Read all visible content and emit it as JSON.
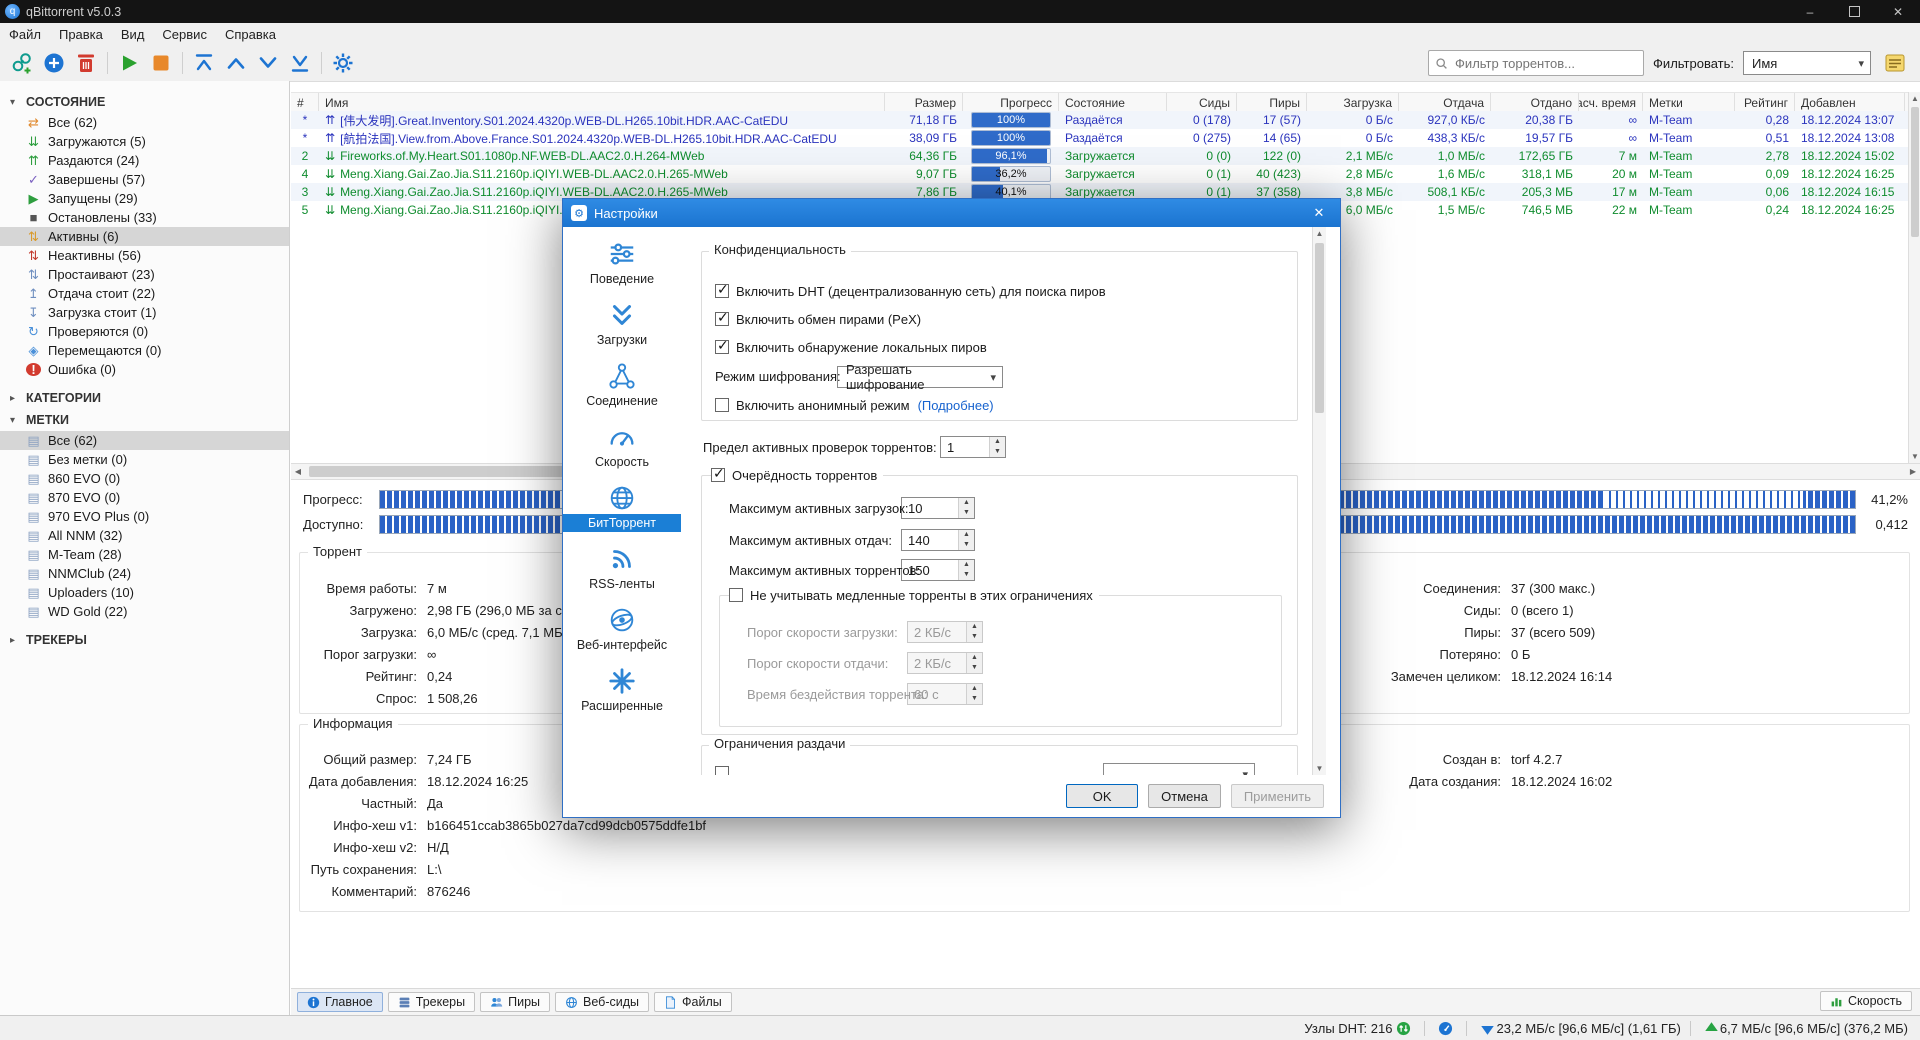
{
  "window": {
    "title": "qBittorrent v5.0.3"
  },
  "menu": [
    "Файл",
    "Правка",
    "Вид",
    "Сервис",
    "Справка"
  ],
  "toolbar": {
    "buttons": [
      "add-link-icon",
      "add-torrent-icon",
      "delete-icon",
      "resume-icon",
      "stop-icon",
      "move-top-icon",
      "move-up-icon",
      "move-down-icon",
      "move-bottom-icon",
      "settings-icon"
    ],
    "search_placeholder": "Фильтр торрентов...",
    "filter_label": "Фильтровать:",
    "filter_value": "Имя",
    "log_icon": "execution-log-icon"
  },
  "sidebar": {
    "sections": [
      {
        "title": "СОСТОЯНИЕ",
        "arrow": "▾",
        "items": [
          {
            "icon": "all",
            "label": "Все (62)",
            "selected": false
          },
          {
            "icon": "downloading",
            "label": "Загружаются (5)",
            "selected": false
          },
          {
            "icon": "seeding",
            "label": "Раздаются (24)",
            "selected": false
          },
          {
            "icon": "completed",
            "label": "Завершены (57)",
            "selected": false
          },
          {
            "icon": "running",
            "label": "Запущены (29)",
            "selected": false
          },
          {
            "icon": "stopped",
            "label": "Остановлены (33)",
            "selected": false
          },
          {
            "icon": "active",
            "label": "Активны (6)",
            "selected": true
          },
          {
            "icon": "inactive",
            "label": "Неактивны (56)",
            "selected": false
          },
          {
            "icon": "stalled",
            "label": "Простаивают (23)",
            "selected": false
          },
          {
            "icon": "stalled-up",
            "label": "Отдача стоит (22)",
            "selected": false
          },
          {
            "icon": "stalled-down",
            "label": "Загрузка стоит (1)",
            "selected": false
          },
          {
            "icon": "checking",
            "label": "Проверяются (0)",
            "selected": false
          },
          {
            "icon": "moving",
            "label": "Перемещаются (0)",
            "selected": false
          },
          {
            "icon": "error",
            "label": "Ошибка (0)",
            "selected": false
          }
        ]
      },
      {
        "title": "КАТЕГОРИИ",
        "arrow": "▸",
        "items": []
      },
      {
        "title": "МЕТКИ",
        "arrow": "▾",
        "items": [
          {
            "icon": "tag",
            "label": "Все (62)",
            "selected": true
          },
          {
            "icon": "tag",
            "label": "Без метки (0)",
            "selected": false
          },
          {
            "icon": "tag",
            "label": "860 EVO (0)",
            "selected": false
          },
          {
            "icon": "tag",
            "label": "870 EVO (0)",
            "selected": false
          },
          {
            "icon": "tag",
            "label": "970 EVO Plus (0)",
            "selected": false
          },
          {
            "icon": "tag",
            "label": "All NNM (32)",
            "selected": false
          },
          {
            "icon": "tag",
            "label": "M-Team (28)",
            "selected": false
          },
          {
            "icon": "tag",
            "label": "NNMClub (24)",
            "selected": false
          },
          {
            "icon": "tag",
            "label": "Uploaders (10)",
            "selected": false
          },
          {
            "icon": "tag",
            "label": "WD Gold (22)",
            "selected": false
          }
        ]
      },
      {
        "title": "ТРЕКЕРЫ",
        "arrow": "▸",
        "items": []
      }
    ]
  },
  "table": {
    "columns": [
      "#",
      "Имя",
      "Размер",
      "Прогресс",
      "Состояние",
      "Сиды",
      "Пиры",
      "Загрузка",
      "Отдача",
      "Отдано",
      "Расч. время",
      "Метки",
      "Рейтинг",
      "Добавлен"
    ],
    "rows": [
      {
        "n": "*",
        "kind": "seed",
        "name": "[伟大发明].Great.Inventory.S01.2024.4320p.WEB-DL.H265.10bit.HDR.AAC-CatEDU",
        "size": "71,18 ГБ",
        "pr": 100,
        "prText": "100%",
        "state": "Раздаётся",
        "seeds": "0 (178)",
        "peers": "17 (57)",
        "dl": "0 Б/с",
        "ul": "927,0 КБ/с",
        "uped": "20,38 ГБ",
        "eta": "∞",
        "tags": "M-Team",
        "ratio": "0,28",
        "added": "18.12.2024 13:07"
      },
      {
        "n": "*",
        "kind": "seed",
        "name": "[航拍法国].View.from.Above.France.S01.2024.4320p.WEB-DL.H265.10bit.HDR.AAC-CatEDU",
        "size": "38,09 ГБ",
        "pr": 100,
        "prText": "100%",
        "state": "Раздаётся",
        "seeds": "0 (275)",
        "peers": "14 (65)",
        "dl": "0 Б/с",
        "ul": "438,3 КБ/с",
        "uped": "19,57 ГБ",
        "eta": "∞",
        "tags": "M-Team",
        "ratio": "0,51",
        "added": "18.12.2024 13:08"
      },
      {
        "n": "2",
        "kind": "down",
        "name": "Fireworks.of.My.Heart.S01.1080p.NF.WEB-DL.AAC2.0.H.264-MWeb",
        "size": "64,36 ГБ",
        "pr": 96.1,
        "prText": "96,1%",
        "state": "Загружается",
        "seeds": "0 (0)",
        "peers": "122 (0)",
        "dl": "2,1 МБ/с",
        "ul": "1,0 МБ/с",
        "uped": "172,65 ГБ",
        "eta": "7 м",
        "tags": "M-Team",
        "ratio": "2,78",
        "added": "18.12.2024 15:02"
      },
      {
        "n": "4",
        "kind": "down",
        "name": "Meng.Xiang.Gai.Zao.Jia.S11.2160p.iQIYI.WEB-DL.AAC2.0.H.265-MWeb",
        "size": "9,07 ГБ",
        "pr": 36.2,
        "prText": "36,2%",
        "state": "Загружается",
        "seeds": "0 (1)",
        "peers": "40 (423)",
        "dl": "2,8 МБ/с",
        "ul": "1,6 МБ/с",
        "uped": "318,1 МБ",
        "eta": "20 м",
        "tags": "M-Team",
        "ratio": "0,09",
        "added": "18.12.2024 16:25"
      },
      {
        "n": "3",
        "kind": "down",
        "name": "Meng.Xiang.Gai.Zao.Jia.S11.2160p.iQIYI.WEB-DL.AAC2.0.H.265-MWeb",
        "size": "7,86 ГБ",
        "pr": 40.1,
        "prText": "40,1%",
        "state": "Загружается",
        "seeds": "0 (1)",
        "peers": "37 (358)",
        "dl": "3,8 МБ/с",
        "ul": "508,1 КБ/с",
        "uped": "205,3 МБ",
        "eta": "17 м",
        "tags": "M-Team",
        "ratio": "0,06",
        "added": "18.12.2024 16:15"
      },
      {
        "n": "5",
        "kind": "down",
        "name": "Meng.Xiang.Gai.Zao.Jia.S11.2160p.iQIYI.WEB-DL.AAC2.0.H.265-MWeb",
        "size": "",
        "pr": null,
        "prText": "",
        "state": "",
        "seeds": "",
        "peers": "",
        "dl": "6,0 МБ/с",
        "ul": "1,5 МБ/с",
        "uped": "746,5 МБ",
        "eta": "22 м",
        "tags": "M-Team",
        "ratio": "0,24",
        "added": "18.12.2024 16:25"
      }
    ]
  },
  "details": {
    "progress_label": "Прогресс:",
    "progress_value": "41,2%",
    "avail_label": "Доступно:",
    "avail_value": "0,412",
    "torrent_group": "Торрент",
    "torrent_left": [
      [
        "Время работы:",
        "7 м"
      ],
      [
        "Загружено:",
        "2,98 ГБ (296,0 МБ за сеанс)"
      ],
      [
        "Загрузка:",
        "6,0 МБ/с (сред. 7,1 МБ/с)"
      ],
      [
        "Порог загрузки:",
        "∞"
      ],
      [
        "Рейтинг:",
        "0,24"
      ],
      [
        "Спрос:",
        "1 508,26"
      ]
    ],
    "torrent_right": [
      [
        "Соединения:",
        "37 (300 макс.)"
      ],
      [
        "Сиды:",
        "0 (всего 1)"
      ],
      [
        "Пиры:",
        "37 (всего 509)"
      ],
      [
        "Потеряно:",
        "0 Б"
      ],
      [
        "Замечен целиком:",
        "18.12.2024 16:14"
      ]
    ],
    "info_group": "Информация",
    "info_left": [
      [
        "Общий размер:",
        "7,24 ГБ"
      ],
      [
        "Дата добавления:",
        "18.12.2024 16:25"
      ],
      [
        "Частный:",
        "Да"
      ],
      [
        "Инфо-хеш v1:",
        "b166451ccab3865b027da7cd99dcb0575ddfe1bf"
      ],
      [
        "Инфо-хеш v2:",
        "Н/Д"
      ],
      [
        "Путь сохранения:",
        "L:\\"
      ],
      [
        "Комментарий:",
        "876246"
      ]
    ],
    "info_right": [
      [
        "Создан в:",
        "torf 4.2.7"
      ],
      [
        "Дата создания:",
        "18.12.2024 16:02"
      ]
    ],
    "tabs": [
      {
        "icon": "info",
        "label": "Главное",
        "selected": true
      },
      {
        "icon": "trackers",
        "label": "Трекеры",
        "selected": false
      },
      {
        "icon": "peers",
        "label": "Пиры",
        "selected": false
      },
      {
        "icon": "webseeds",
        "label": "Веб-сиды",
        "selected": false
      },
      {
        "icon": "files",
        "label": "Файлы",
        "selected": false
      }
    ],
    "speed_button": "Скорость"
  },
  "dialog": {
    "title": "Настройки",
    "nav": [
      {
        "icon": "behavior",
        "label": "Поведение",
        "selected": false
      },
      {
        "icon": "downloads",
        "label": "Загрузки",
        "selected": false
      },
      {
        "icon": "connection",
        "label": "Соединение",
        "selected": false
      },
      {
        "icon": "speed",
        "label": "Скорость",
        "selected": false
      },
      {
        "icon": "bittorrent",
        "label": "БитТоррент",
        "selected": true
      },
      {
        "icon": "rss",
        "label": "RSS-ленты",
        "selected": false
      },
      {
        "icon": "webui",
        "label": "Веб-интерфейс",
        "selected": false
      },
      {
        "icon": "advanced",
        "label": "Расширенные",
        "selected": false
      }
    ],
    "section_privacy": "Конфиденциальность",
    "privacy_checkboxes": [
      {
        "checked": true,
        "label": "Включить DHT (децентрализованную сеть) для поиска пиров"
      },
      {
        "checked": true,
        "label": "Включить обмен пирами (PeX)"
      },
      {
        "checked": true,
        "label": "Включить обнаружение локальных пиров"
      }
    ],
    "encryption_label": "Режим шифрования:",
    "encryption_value": "Разрешать шифрование",
    "anonymous_label": "Включить анонимный режим",
    "anonymous_link": "(Подробнее)",
    "max_checks_label": "Предел активных проверок торрентов:",
    "max_checks_value": "1",
    "queueing_label": "Очерёдность торрентов",
    "queue_fields": [
      {
        "label": "Максимум активных загрузок:",
        "value": "10"
      },
      {
        "label": "Максимум активных отдач:",
        "value": "140"
      },
      {
        "label": "Максимум активных торрентов:",
        "value": "150"
      }
    ],
    "slow_label": "Не учитывать медленные торренты в этих ограничениях",
    "slow_fields": [
      {
        "label": "Порог скорости загрузки:",
        "value": "2 КБ/с"
      },
      {
        "label": "Порог скорости отдачи:",
        "value": "2 КБ/с"
      },
      {
        "label": "Время бездействия торрента:",
        "value": "60 с"
      }
    ],
    "section_share": "Ограничения раздачи",
    "buttons": {
      "ok": "OK",
      "cancel": "Отмена",
      "apply": "Применить"
    }
  },
  "statusbar": {
    "icons": [
      "connection-status-icon",
      "speed-limits-icon",
      "download-arrow-icon",
      "upload-arrow-icon"
    ],
    "dht": "Узлы DHT: 216",
    "down": "23,2 МБ/с [96,6 МБ/с] (1,61 ГБ)",
    "up": "6,7 МБ/с [96,6 МБ/с] (376,2 МБ)"
  }
}
